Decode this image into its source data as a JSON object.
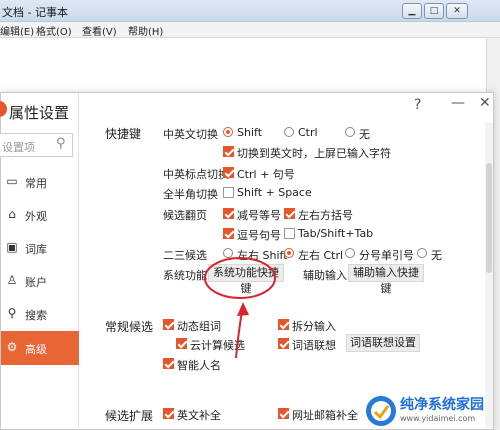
{
  "notepad": {
    "title": "文档 - 记事本",
    "menu": [
      "编辑(E)",
      "格式(O)",
      "查看(V)",
      "帮助(H)"
    ]
  },
  "dialog": {
    "title": "属性设置",
    "search_placeholder": "设置项",
    "help": "?",
    "minimize": "—",
    "close": "✕",
    "sidebar": [
      {
        "label": "常用",
        "icon": "monitor-icon"
      },
      {
        "label": "外观",
        "icon": "shirt-icon"
      },
      {
        "label": "词库",
        "icon": "book-icon"
      },
      {
        "label": "账户",
        "icon": "user-icon"
      },
      {
        "label": "搜索",
        "icon": "search-icon"
      },
      {
        "label": "高级",
        "icon": "gear-icon",
        "active": true
      }
    ],
    "hotkeys": {
      "section": "快捷键",
      "cn_en_switch": {
        "label": "中英文切换",
        "options": [
          "Shift",
          "Ctrl",
          "无"
        ],
        "selected": "Shift",
        "extra": "切换到英文时，上屏已输入字符",
        "extra_checked": true
      },
      "punct_switch": {
        "label": "中英标点切换",
        "option": "Ctrl + 句号",
        "checked": true
      },
      "width_switch": {
        "label": "全半角切换",
        "option": "Shift + Space",
        "checked": false
      },
      "paging": {
        "label": "候选翻页",
        "options": [
          {
            "text": "减号等号",
            "checked": true
          },
          {
            "text": "左右方括号",
            "checked": true
          },
          {
            "text": "逗号句号",
            "checked": true
          },
          {
            "text": "Tab/Shift+Tab",
            "checked": false
          }
        ]
      },
      "second_third": {
        "label": "二三候选",
        "options": [
          "左右 Shift",
          "左右 Ctrl",
          "分号单引号",
          "无"
        ],
        "selected": "左右 Ctrl"
      },
      "system_function": {
        "label": "系统功能",
        "button": "系统功能快捷键",
        "assist_label": "辅助输入",
        "assist_button": "辅助输入快捷键"
      }
    },
    "common_candidates": {
      "section": "常规候选",
      "options": [
        {
          "text": "动态组词",
          "checked": true
        },
        {
          "text": "拆分输入",
          "checked": true
        },
        {
          "text": "云计算候选",
          "checked": true
        },
        {
          "text": "词语联想",
          "checked": true
        },
        {
          "text": "智能人名",
          "checked": true
        }
      ],
      "association_button": "词语联想设置"
    },
    "candidate_ext": {
      "section": "候选扩展",
      "options": [
        {
          "text": "英文补全",
          "checked": true
        },
        {
          "text": "网址邮箱补全",
          "checked": true
        }
      ]
    }
  },
  "watermark": {
    "title": "纯净系统家园",
    "url": "www.yidaimei.com"
  },
  "colors": {
    "accent": "#e8552a",
    "annotation": "#d9252a",
    "sidebar_active": "#e86536"
  }
}
